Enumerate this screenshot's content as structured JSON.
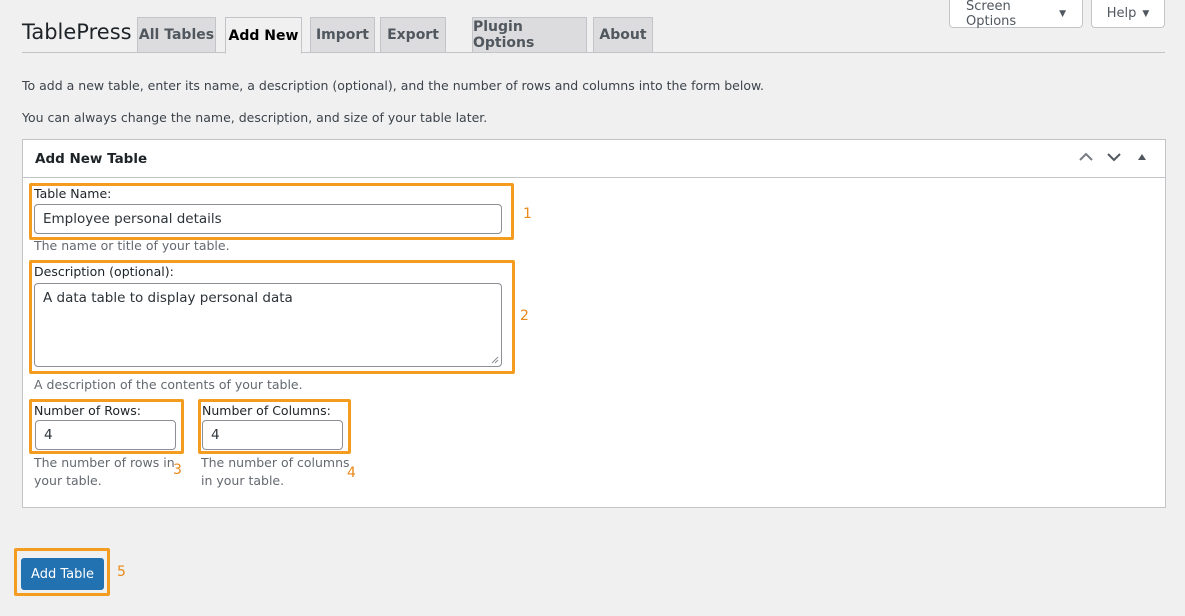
{
  "screen_meta": {
    "screen_options": "Screen Options",
    "help": "Help",
    "caret": "▼"
  },
  "header": {
    "brand": "TablePress",
    "tabs": [
      {
        "label": "All Tables"
      },
      {
        "label": "Add New",
        "active": true
      },
      {
        "label": "Import"
      },
      {
        "label": "Export"
      },
      {
        "label": "Plugin Options"
      },
      {
        "label": "About"
      }
    ]
  },
  "intro": {
    "line1": "To add a new table, enter its name, a description (optional), and the number of rows and columns into the form below.",
    "line2": "You can always change the name, description, and size of your table later."
  },
  "postbox": {
    "title": "Add New Table",
    "icons": [
      "chevron-up-icon",
      "chevron-down-icon",
      "triangle-up-icon"
    ]
  },
  "form": {
    "table_name": {
      "label": "Table Name:",
      "value": "Employee personal details",
      "hint": "The name or title of your table."
    },
    "description": {
      "label": "Description (optional):",
      "value": "A data table to display personal data",
      "hint": "A description of the contents of your table."
    },
    "rows": {
      "label": "Number of Rows:",
      "value": "4",
      "hint_line1": "The number of rows in",
      "hint_line2": "your table."
    },
    "columns": {
      "label": "Number of Columns:",
      "value": "4",
      "hint_line1": "The number of columns",
      "hint_line2": "in your table."
    },
    "submit": "Add Table"
  },
  "annotations": {
    "callouts": [
      "1",
      "2",
      "3",
      "4",
      "5"
    ],
    "color": "#f39c1f"
  }
}
